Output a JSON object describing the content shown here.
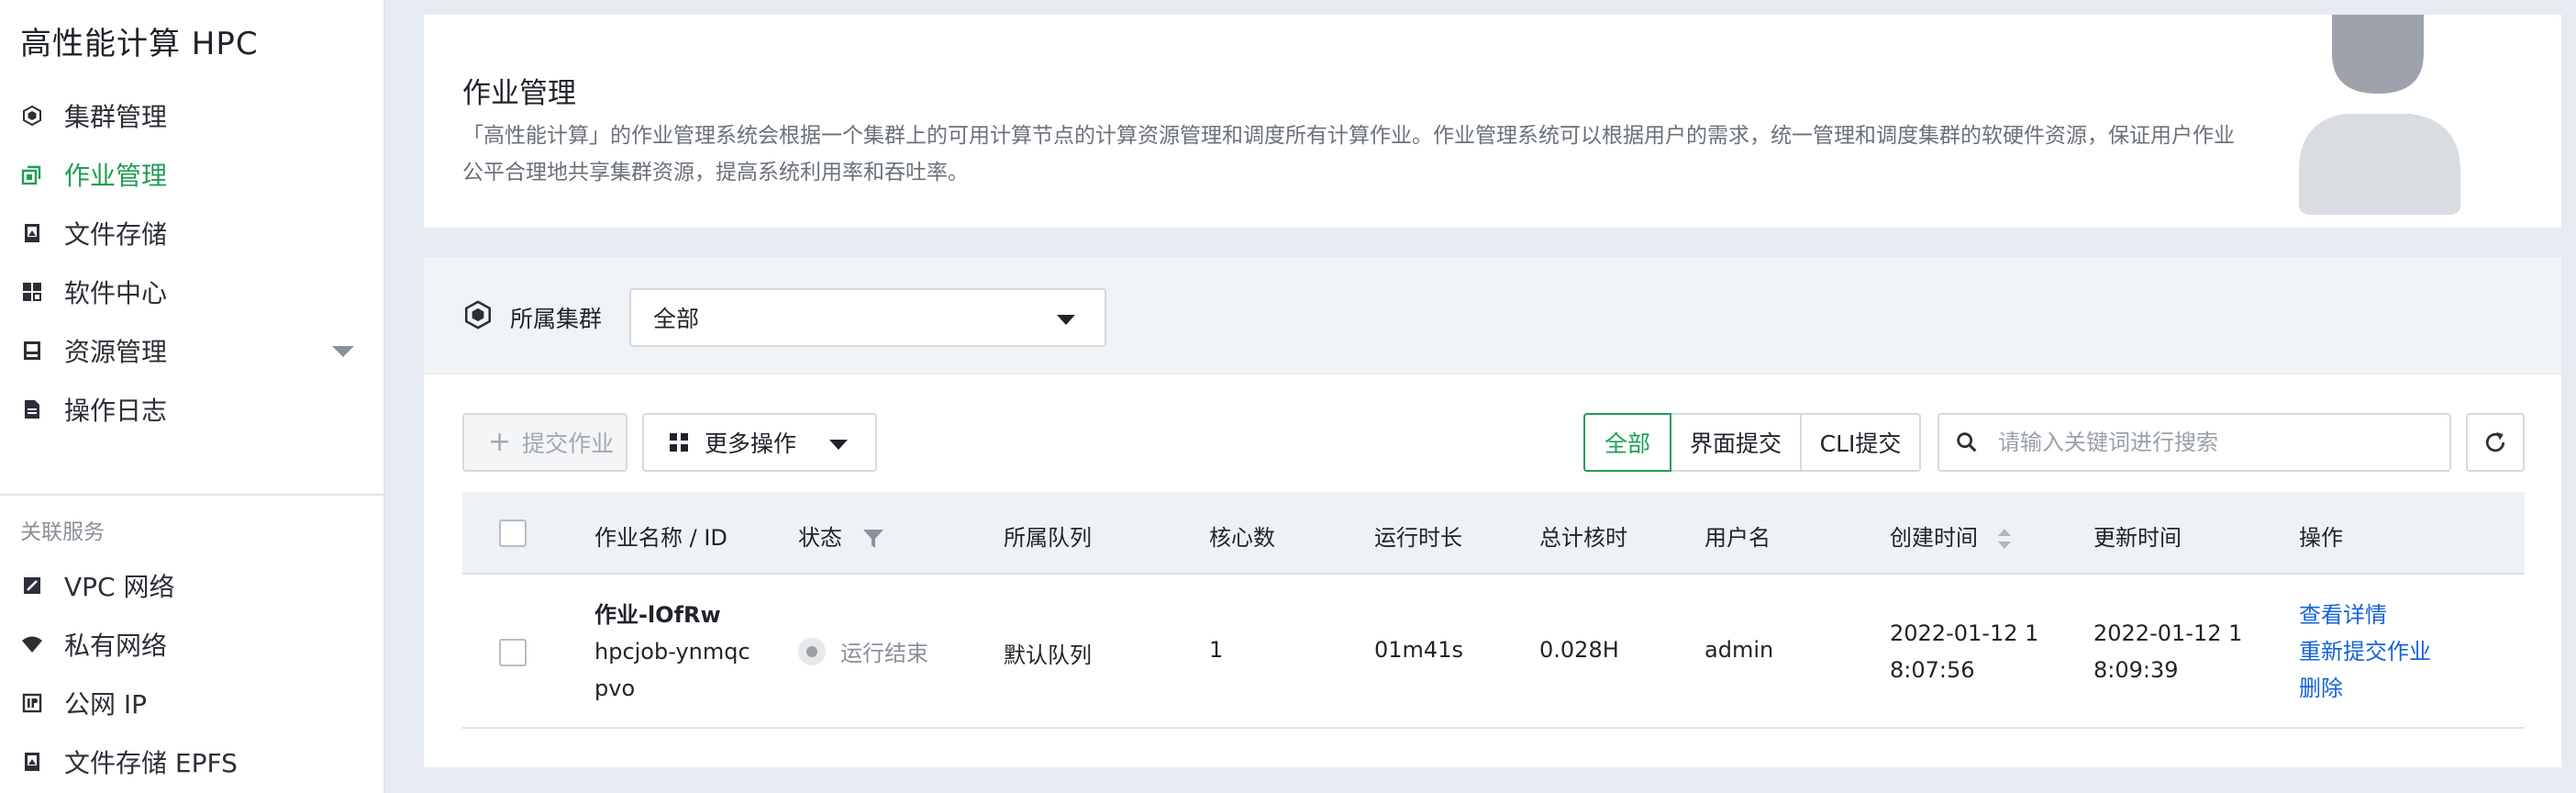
{
  "brand": "高性能计算 HPC",
  "sidebar": {
    "items": [
      {
        "label": "集群管理",
        "icon": "cluster-icon"
      },
      {
        "label": "作业管理",
        "icon": "job-icon",
        "active": true
      },
      {
        "label": "文件存储",
        "icon": "storage-icon"
      },
      {
        "label": "软件中心",
        "icon": "apps-icon"
      },
      {
        "label": "资源管理",
        "icon": "resource-icon",
        "expandable": true
      },
      {
        "label": "操作日志",
        "icon": "log-icon"
      }
    ],
    "related_title": "关联服务",
    "related": [
      {
        "label": "VPC 网络",
        "icon": "vpc-icon"
      },
      {
        "label": "私有网络",
        "icon": "wifi-icon"
      },
      {
        "label": "公网 IP",
        "icon": "ip-icon"
      },
      {
        "label": "文件存储 EPFS",
        "icon": "storage-icon"
      }
    ]
  },
  "intro": {
    "title": "作业管理",
    "description": "「高性能计算」的作业管理系统会根据一个集群上的可用计算节点的计算资源管理和调度所有计算作业。作业管理系统可以根据用户的需求，统一管理和调度集群的软硬件资源，保证用户作业公平合理地共享集群资源，提高系统利用率和吞吐率。"
  },
  "filter": {
    "label": "所属集群",
    "selected": "全部"
  },
  "toolbar": {
    "submit_label": "提交作业",
    "more_label": "更多操作",
    "segments": [
      "全部",
      "界面提交",
      "CLI提交"
    ],
    "active_segment": 0,
    "search_placeholder": "请输入关键词进行搜索"
  },
  "table": {
    "headers": [
      "作业名称 / ID",
      "状态",
      "所属队列",
      "核心数",
      "运行时长",
      "总计核时",
      "用户名",
      "创建时间",
      "更新时间",
      "操作"
    ],
    "rows": [
      {
        "name": "作业-lOfRw",
        "id_line1": "hpcjob-ynmqc",
        "id_line2": "pvo",
        "status": "运行结束",
        "queue": "默认队列",
        "cores": "1",
        "duration": "01m41s",
        "core_hours": "0.028H",
        "user": "admin",
        "created_line1": "2022-01-12 1",
        "created_line2": "8:07:56",
        "updated_line1": "2022-01-12 1",
        "updated_line2": "8:09:39",
        "actions": [
          "查看详情",
          "重新提交作业",
          "删除"
        ]
      }
    ]
  },
  "colors": {
    "accent": "#1f9d55",
    "link": "#1663d6",
    "sidebar_bg": "#ffffff",
    "page_bg": "#e6ebf1"
  }
}
